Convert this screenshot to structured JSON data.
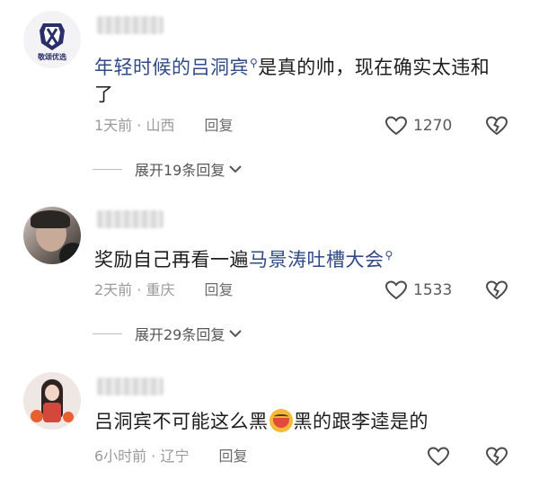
{
  "comments": [
    {
      "avatar_badge": "敬颂优选",
      "text_link": "年轻时候的吕洞宾",
      "text_rest": "是真的帅，现在确实太违和了",
      "time": "1天前 · 山西",
      "reply_label": "回复",
      "likes": "1270",
      "expand_label": "展开19条回复"
    },
    {
      "text_prefix": "奖励自己再看一遍",
      "text_link": "马景涛吐槽大会",
      "time": "2天前 · 重庆",
      "reply_label": "回复",
      "likes": "1533",
      "expand_label": "展开29条回复"
    },
    {
      "text_before": "吕洞宾不可能这么黑",
      "text_after": "黑的跟李逵是的",
      "time": "6小时前 · 辽宁",
      "reply_label": "回复"
    }
  ],
  "icons": {
    "like": "heart-outline-icon",
    "dislike": "broken-heart-icon",
    "search": "search-icon",
    "expand": "chevron-down-icon"
  },
  "colors": {
    "link": "#2f4a86",
    "meta": "#9a9a9a"
  }
}
